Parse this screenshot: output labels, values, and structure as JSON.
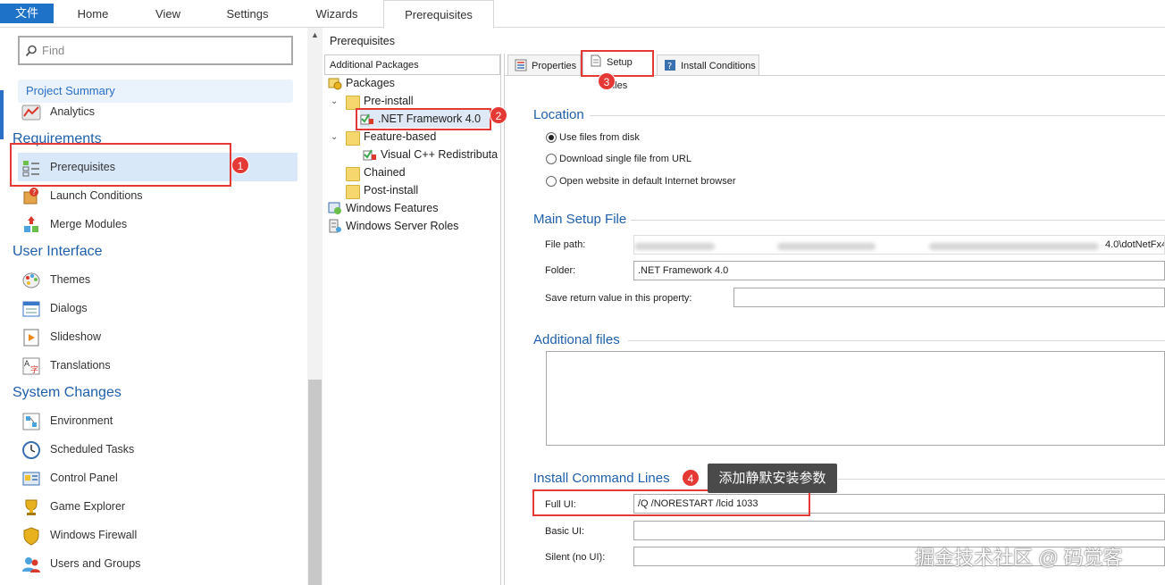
{
  "ribbon": {
    "tabs": [
      {
        "label": "文件"
      },
      {
        "label": "Home"
      },
      {
        "label": "View"
      },
      {
        "label": "Settings"
      },
      {
        "label": "Wizards"
      },
      {
        "label": "Prerequisites"
      }
    ]
  },
  "left": {
    "search_placeholder": "Find",
    "project_summary": "Project Summary",
    "analytics": "Analytics",
    "sections": {
      "requirements": "Requirements",
      "user_interface": "User Interface",
      "system_changes": "System Changes"
    },
    "items": {
      "prerequisites": "Prerequisites",
      "launch_conditions": "Launch Conditions",
      "merge_modules": "Merge Modules",
      "themes": "Themes",
      "dialogs": "Dialogs",
      "slideshow": "Slideshow",
      "translations": "Translations",
      "environment": "Environment",
      "scheduled_tasks": "Scheduled Tasks",
      "control_panel": "Control Panel",
      "game_explorer": "Game Explorer",
      "windows_firewall": "Windows Firewall",
      "users_and_groups": "Users and Groups"
    }
  },
  "middle": {
    "breadcrumb": "Prerequisites",
    "panel_header": "Additional Packages",
    "tree": {
      "packages": "Packages",
      "pre_install": "Pre-install",
      "netfx": ".NET Framework 4.0",
      "feature_based": "Feature-based",
      "vcpp": "Visual C++ Redistributa",
      "chained": "Chained",
      "post_install": "Post-install",
      "windows_features": "Windows Features",
      "windows_server_roles": "Windows Server Roles"
    }
  },
  "right": {
    "tabs": {
      "properties": "Properties",
      "setup_files": "Setup Files",
      "install_conditions": "Install Conditions"
    },
    "location": {
      "title": "Location",
      "opt_disk": "Use files from disk",
      "opt_url": "Download single file from URL",
      "opt_browser": "Open website in default Internet browser"
    },
    "main_setup": {
      "title": "Main Setup File",
      "file_path_label": "File path:",
      "file_path_value": "4.0\\dotNetFx4",
      "folder_label": "Folder:",
      "folder_value": ".NET Framework 4.0",
      "save_label": "Save return value in this property:",
      "save_value": ""
    },
    "additional_files": {
      "title": "Additional files"
    },
    "install_cmd": {
      "title": "Install Command Lines",
      "full_label": "Full UI:",
      "full_value": "/Q /NORESTART /lcid 1033",
      "basic_label": "Basic UI:",
      "basic_value": "",
      "silent_label": "Silent (no UI):",
      "silent_value": ""
    }
  },
  "annotations": {
    "b1": "1",
    "b2": "2",
    "b3": "3",
    "b4": "4",
    "tooltip": "添加静默安装参数",
    "watermark": "掘金技术社区 @ 码觉客"
  }
}
